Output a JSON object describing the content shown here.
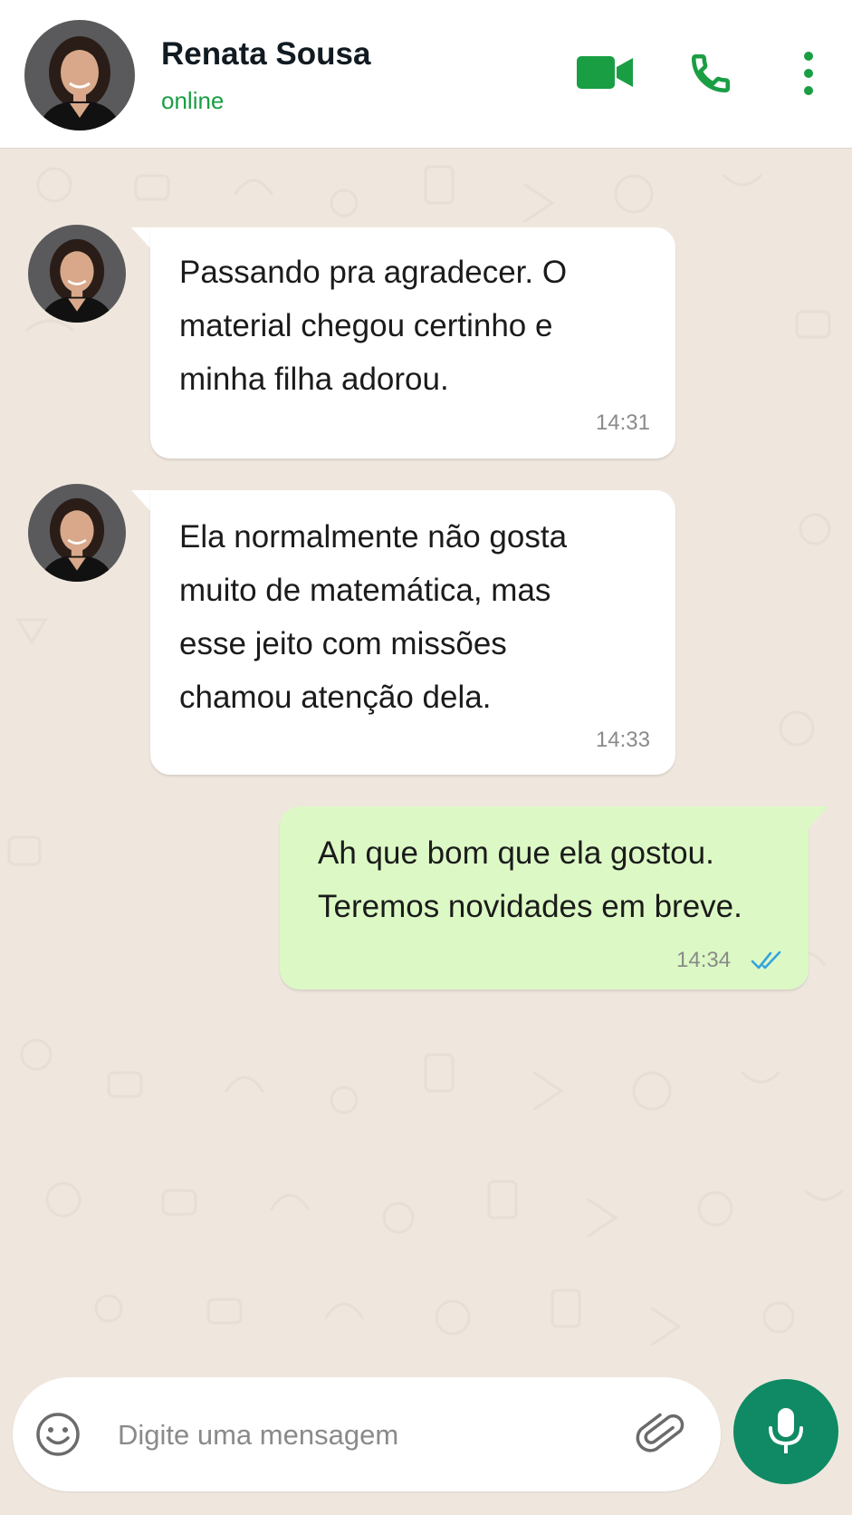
{
  "header": {
    "contact_name": "Renata Sousa",
    "status": "online",
    "icons": [
      "video-call-icon",
      "voice-call-icon",
      "more-options-icon"
    ]
  },
  "messages": [
    {
      "direction": "incoming",
      "lines": [
        "Passando pra agradecer. O",
        "material chegou certinho e",
        "minha filha adorou."
      ],
      "time": "14:31"
    },
    {
      "direction": "incoming",
      "lines": [
        "Ela normalmente não gosta",
        "muito de matemática, mas",
        "esse jeito com missões",
        "chamou atenção dela."
      ],
      "time": "14:33"
    },
    {
      "direction": "outgoing",
      "lines": [
        "Ah que bom que ela gostou.",
        "Teremos novidades em breve."
      ],
      "time": "14:34",
      "read_receipt": "double-check-icon"
    }
  ],
  "composer": {
    "placeholder": "Digite uma mensagem",
    "value": "",
    "icons": [
      "emoji-icon",
      "attach-icon",
      "mic-icon"
    ]
  },
  "colors": {
    "brand_green": "#1a9e43",
    "mic_button": "#0f8a64",
    "chat_background": "#efe7de",
    "outgoing_bubble": "#dcf9c5",
    "incoming_bubble": "#ffffff",
    "read_tick": "#34a3e0"
  }
}
